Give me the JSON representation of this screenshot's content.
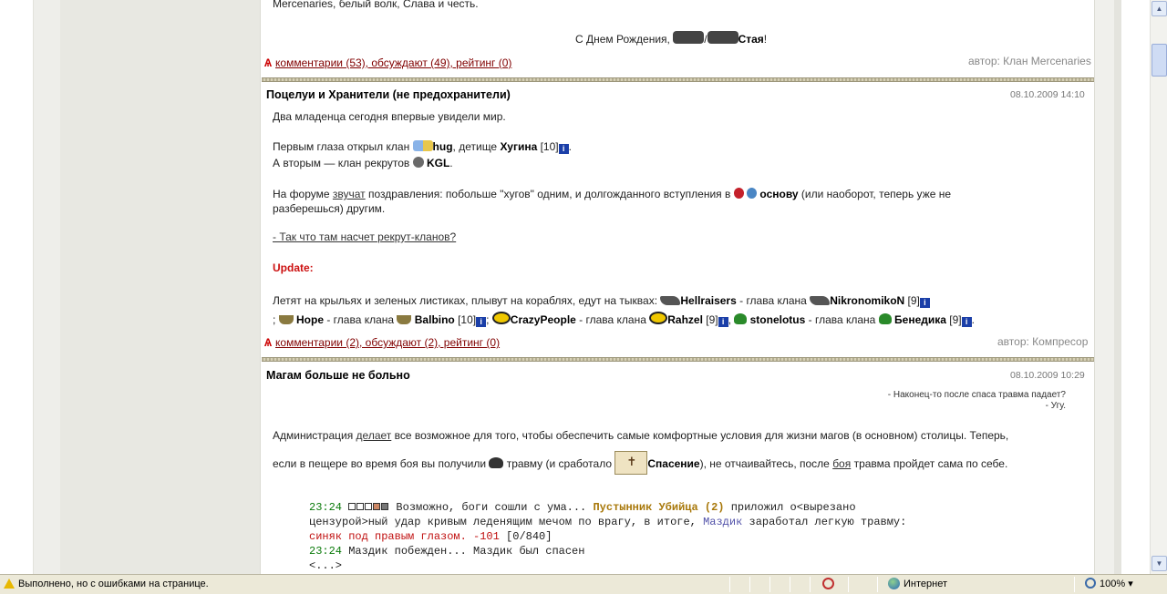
{
  "post1": {
    "tail_text": "Mercenaries, белый волк, Слава и честь.",
    "birthday_prefix": "С Днем Рождения, ",
    "birthday_slash": "/",
    "birthday_name": "Стая",
    "birthday_suffix": "!",
    "comments": "комментарии (53), обсуждают (49), рейтинг (0)",
    "author": "автор: Клан Mercenaries"
  },
  "post2": {
    "title": "Поцелуи и Хранители (не предохранители)",
    "date": "08.10.2009 14:10",
    "line1": "Два младенца сегодня впервые увидели мир.",
    "line2_prefix": "Первым глаза открыл клан ",
    "line2_clan": "hug",
    "line2_mid": ", детище ",
    "line2_name": "Хугина",
    "line2_level": " [10]",
    "line2_suffix": ".",
    "line3_prefix": "А вторым — клан рекрутов ",
    "line3_clan": "KGL",
    "line3_suffix": ".",
    "forum_prefix": "На форуме ",
    "forum_link": "звучат",
    "forum_mid": " поздравления: побольше \"хугов\" одним, и долгожданного вступления в ",
    "forum_bold": "основу",
    "forum_suffix": " (или наоборот, теперь уже не",
    "forum_line2": "разберешься) другим.",
    "question_link": "- Так что там насчет рекрут-кланов?",
    "update_label": "Update:",
    "fly_line1_prefix": "Летят на крыльях и зеленых листиках, плывут на кораблях, едут на тыквах: ",
    "fly_clan1": "Hellraisers",
    "fly_head1": " - глава клана ",
    "fly_name1": "NikronomikoN",
    "fly_lvl1": " [9]",
    "fly_line2_semi": "; ",
    "fly_clan2": "Hope",
    "fly_head2": " - глава клана ",
    "fly_name2": "Balbino",
    "fly_lvl2": " [10]",
    "fly_sep2": "; ",
    "fly_clan3": "CrazyPeople",
    "fly_head3": " - глава клана ",
    "fly_name3": "Rahzel",
    "fly_lvl3": " [9]",
    "fly_sep3": ", ",
    "fly_clan4": "stonelotus",
    "fly_head4": " - глава клана ",
    "fly_name4": "Бенедика",
    "fly_lvl4": " [9]",
    "fly_end": ".",
    "info_glyph": "i",
    "comments": "комментарии (2), обсуждают (2), рейтинг (0)",
    "author": "автор: Компресор"
  },
  "post3": {
    "title": "Магам больше не больно",
    "date": "08.10.2009 10:29",
    "epigraph1": "- Наконец-то после спаса травма падает?",
    "epigraph2": "- Угу.",
    "para1_prefix": "Администрация ",
    "para1_link": "делает",
    "para1_suffix": " все возможное для того, чтобы обеспечить самые комфортные условия для жизни магов (в основном) столицы. Теперь,",
    "para2_prefix": "если в пещере во время боя вы получили ",
    "para2_mid": "травму (и сработало ",
    "para2_bold": "Спасение",
    "para2_after": "), не отчаивайтесь, после ",
    "para2_link": "боя",
    "para2_suffix": " травма пройдет сама по себе.",
    "log": {
      "time1": "23:24",
      "text1a": " Возможно, боги сошли с ума... ",
      "name1": "Пустынник Убийца (2)",
      "text1b": " приложил о<вырезано",
      "line2a": "цензурой>ный удар кривым леденящим мечом по врагу, в итоге, ",
      "name2": "Маздик",
      "line2b": " заработал легкую травму:",
      "line3_red": "синяк под правым глазом. -101",
      "line3_hp": " [0/840]",
      "time2": "23:24",
      "text4": " Маздик побежден... Маздик был спасен",
      "text5": "<...>"
    }
  },
  "statusbar": {
    "status_text": "Выполнено, но с ошибками на странице.",
    "zone": "Интернет",
    "zoom": "100%",
    "zoom_caret": "▾"
  },
  "scrollbar": {
    "up_glyph": "▲",
    "down_glyph": "▼"
  },
  "colors": {
    "separator": "#b4ae92",
    "comment_link": "#800000",
    "update": "#cc1111",
    "info_badge": "#1b3fa8"
  }
}
